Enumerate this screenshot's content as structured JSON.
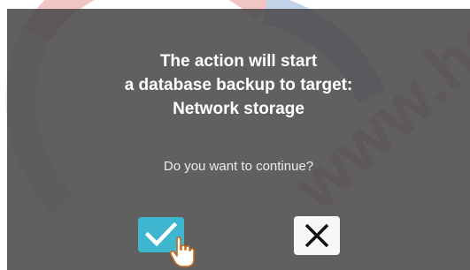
{
  "dialog": {
    "message_lines": [
      "The action will start",
      "a database backup to target:",
      "Network storage"
    ],
    "question": "Do you want to continue?",
    "confirm_icon": "checkmark-icon",
    "cancel_icon": "close-icon",
    "cursor_icon": "hand-pointer-icon"
  },
  "colors": {
    "overlay": "#464646",
    "confirm_button": "#3fb6cf",
    "cancel_button": "#f7f7f7",
    "watermark_red": "#d9534f",
    "watermark_blue": "#2a6eb8"
  }
}
